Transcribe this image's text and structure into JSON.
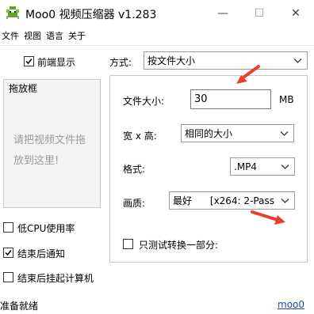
{
  "window": {
    "title": "Moo0 视频压缩器 v1.283",
    "minimize_glyph": "—",
    "maximize_glyph": "☐",
    "close_glyph": "✕"
  },
  "menu": [
    {
      "label": "文件"
    },
    {
      "label": "视图"
    },
    {
      "label": "语言"
    },
    {
      "label": "关于"
    }
  ],
  "left": {
    "topmost": {
      "label": "前端显示",
      "checked": true
    },
    "dropbox": {
      "title": "拖放框",
      "hint_line1": "请把视频文件拖",
      "hint_line2": "放到这里!"
    },
    "low_cpu": {
      "label": "低CPU使用率",
      "checked": false
    },
    "notify_done": {
      "label": "结束后通知",
      "checked": true
    },
    "shutdown_after": {
      "label": "结束后挂起计算机",
      "checked": false
    }
  },
  "method": {
    "label": "方式:",
    "value": "按文件大小"
  },
  "settings": {
    "file_size": {
      "label": "文件大小:",
      "value": "30",
      "unit": "MB"
    },
    "dimensions": {
      "label": "宽 x 高:",
      "value": "相同的大小"
    },
    "format": {
      "label": "格式:",
      "value": ".MP4"
    },
    "quality": {
      "label": "画质:",
      "value": "最好      [x264: 2-Pass"
    },
    "test_part": {
      "label": "只测试转换一部分:",
      "checked": false
    }
  },
  "status": {
    "text": "准备就绪",
    "link": "moo0"
  },
  "colors": {
    "accent_arrow": "#e8402c",
    "link": "#1a4fa0"
  }
}
